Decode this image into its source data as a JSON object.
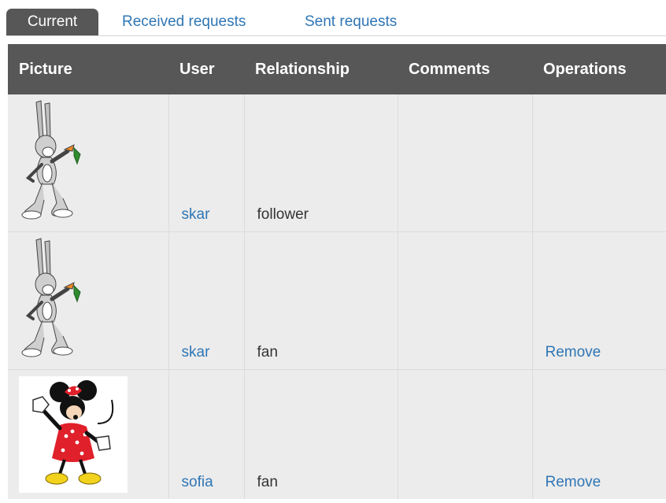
{
  "tabs": [
    {
      "label": "Current",
      "active": true
    },
    {
      "label": "Received requests",
      "active": false
    },
    {
      "label": "Sent requests",
      "active": false
    }
  ],
  "table": {
    "headers": [
      "Picture",
      "User",
      "Relationship",
      "Comments",
      "Operations"
    ],
    "rows": [
      {
        "picture": "bugs-bunny-avatar",
        "user": "skar",
        "relationship": "follower",
        "comments": "",
        "operation": ""
      },
      {
        "picture": "bugs-bunny-avatar",
        "user": "skar",
        "relationship": "fan",
        "comments": "",
        "operation": "Remove"
      },
      {
        "picture": "minnie-mouse-avatar",
        "user": "sofia",
        "relationship": "fan",
        "comments": "",
        "operation": "Remove"
      }
    ]
  },
  "colors": {
    "header_bg": "#575757",
    "row_bg": "#ececec",
    "link": "#2f76b5"
  }
}
